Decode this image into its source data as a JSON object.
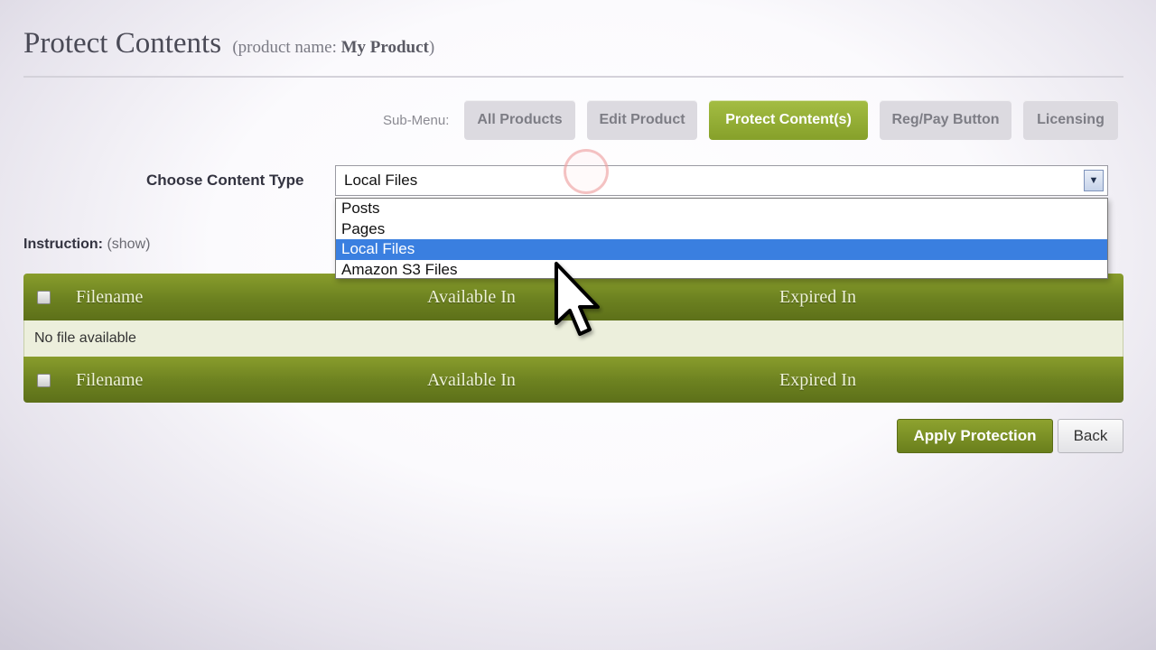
{
  "page": {
    "title": "Protect Contents",
    "subtitle_prefix": "(product name: ",
    "product_name": "My Product",
    "subtitle_suffix": ")"
  },
  "submenu": {
    "label": "Sub-Menu:",
    "tabs": [
      {
        "label": "All Products",
        "active": false
      },
      {
        "label": "Edit Product",
        "active": false
      },
      {
        "label": "Protect Content(s)",
        "active": true
      },
      {
        "label": "Reg/Pay Button",
        "active": false
      },
      {
        "label": "Licensing",
        "active": false
      }
    ]
  },
  "content_type": {
    "label": "Choose Content Type",
    "selected": "Local Files",
    "options": [
      "Posts",
      "Pages",
      "Local Files",
      "Amazon S3 Files"
    ]
  },
  "instruction": {
    "label": "Instruction:",
    "toggle": "(show)"
  },
  "table": {
    "columns": [
      "Filename",
      "Available In",
      "Expired In"
    ],
    "empty_message": "No file available"
  },
  "actions": {
    "apply_label": "Apply Protection",
    "back_label": "Back"
  },
  "colors": {
    "accent_green": "#86a02a",
    "table_header_green": "#6c8120",
    "selected_option_blue": "#3a7fe0"
  },
  "icons": {
    "dropdown_arrow": "chevron-down-icon",
    "cursor": "mouse-pointer-icon"
  }
}
